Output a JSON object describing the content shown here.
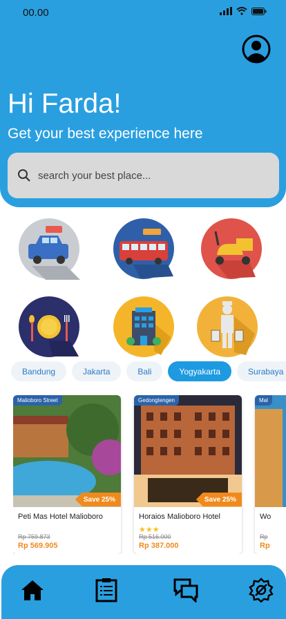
{
  "status": {
    "time": "00.00"
  },
  "header": {
    "greeting": "Hi Farda!",
    "subtitle": "Get your best experience here"
  },
  "search": {
    "placeholder": "search your best place..."
  },
  "categories": [
    {
      "icon": "car-rental-icon"
    },
    {
      "icon": "bus-icon"
    },
    {
      "icon": "scooter-icon"
    },
    {
      "icon": "restaurant-icon"
    },
    {
      "icon": "hotel-icon"
    },
    {
      "icon": "porter-icon"
    }
  ],
  "cities": [
    {
      "label": "Bandung",
      "active": false
    },
    {
      "label": "Jakarta",
      "active": false
    },
    {
      "label": "Bali",
      "active": false
    },
    {
      "label": "Yogyakarta",
      "active": true
    },
    {
      "label": "Surabaya",
      "active": false
    }
  ],
  "hotels": [
    {
      "location": "Malioboro Street",
      "save": "Save 25%",
      "name": "Peti Mas Hotel Malioboro",
      "stars": 0,
      "old_price": "Rp 759.873",
      "new_price": "Rp 569.905"
    },
    {
      "location": "Gedongtengen",
      "save": "Save 25%",
      "name": "Horaios Malioboro Hotel",
      "stars": 3,
      "old_price": "Rp 516.000",
      "new_price": "Rp 387.000"
    },
    {
      "location": "Mal",
      "save": "",
      "name": "Wo",
      "stars": 0,
      "old_price": "Rp",
      "new_price": "Rp"
    }
  ],
  "nav": [
    {
      "icon": "home-icon"
    },
    {
      "icon": "clipboard-icon"
    },
    {
      "icon": "chat-icon"
    },
    {
      "icon": "settings-icon"
    }
  ],
  "colors": {
    "primary": "#2A9FE0",
    "accent": "#F08A1C",
    "badge": "#2B63A8"
  }
}
